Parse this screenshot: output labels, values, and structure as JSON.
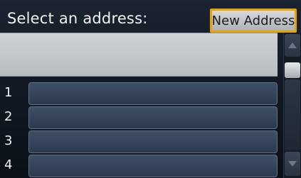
{
  "header": {
    "title": "Select an address:"
  },
  "new_address_button": {
    "label": "New Address"
  },
  "address_list": {
    "rows": [
      {
        "number": "1",
        "value": ""
      },
      {
        "number": "2",
        "value": ""
      },
      {
        "number": "3",
        "value": ""
      },
      {
        "number": "4",
        "value": ""
      }
    ]
  },
  "scrollbar": {
    "up_icon": "triangle-up-icon",
    "down_icon": "triangle-down-icon"
  },
  "colors": {
    "highlight_border": "#e8a300",
    "row_field": "#34435a",
    "display_box": "#c4c8cc"
  }
}
